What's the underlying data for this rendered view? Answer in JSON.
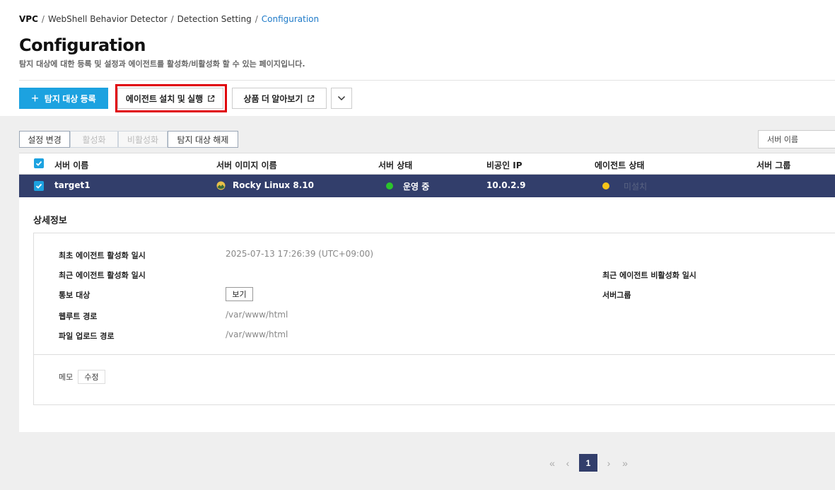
{
  "breadcrumb": [
    "VPC",
    "WebShell Behavior Detector",
    "Detection Setting",
    "Configuration"
  ],
  "header": {
    "title": "Configuration",
    "description": "탐지 대상에 대한 등록 및 설정과 에이전트를 활성화/비활성화 할 수 있는 페이지입니다."
  },
  "actions": {
    "register_label": "탐지 대상 등록",
    "install_label": "에이전트 설치 및 실행",
    "learn_label": "상품 더 알아보기"
  },
  "toolbar": {
    "change_label": "설정 변경",
    "activate_label": "활성화",
    "deactivate_label": "비활성화",
    "release_label": "탐지 대상 해제",
    "search_label": "서버 이름"
  },
  "table": {
    "columns": [
      "서버 이름",
      "서버 이미지 이름",
      "서버 상태",
      "비공인 IP",
      "에이전트 상태",
      "서버 그룹"
    ],
    "rows": [
      {
        "server_name": "target1",
        "image_name": "Rocky Linux 8.10",
        "server_status": "운영 중",
        "private_ip": "10.0.2.9",
        "agent_status": "미설치",
        "server_group": "",
        "colors": {
          "server_status": "#2bc42b",
          "agent_status": "#f5c518"
        }
      }
    ]
  },
  "detail": {
    "title": "상세정보",
    "first_activation_label": "최초 에이전트 활성화 일시",
    "first_activation_value": "2025-07-13 17:26:39 (UTC+09:00)",
    "recent_activation_label": "최근 에이전트 활성화 일시",
    "recent_deactivation_label": "최근 에이전트 비활성화 일시",
    "notify_label": "통보 대상",
    "notify_button": "보기",
    "server_group_label": "서버그룹",
    "webroot_label": "웹루트 경로",
    "webroot_value": "/var/www/html",
    "upload_label": "파일 업로드 경로",
    "upload_value": "/var/www/html",
    "memo_label": "메모",
    "memo_button": "수정"
  },
  "pagination": {
    "first": "«",
    "prev": "‹",
    "current": "1",
    "next": "›",
    "last": "»"
  },
  "colors": {
    "primary": "#1ca2e0",
    "selected_row": "#323e6b",
    "highlight": "#e0000a",
    "breadcrumb_current": "#1e7ac8"
  }
}
